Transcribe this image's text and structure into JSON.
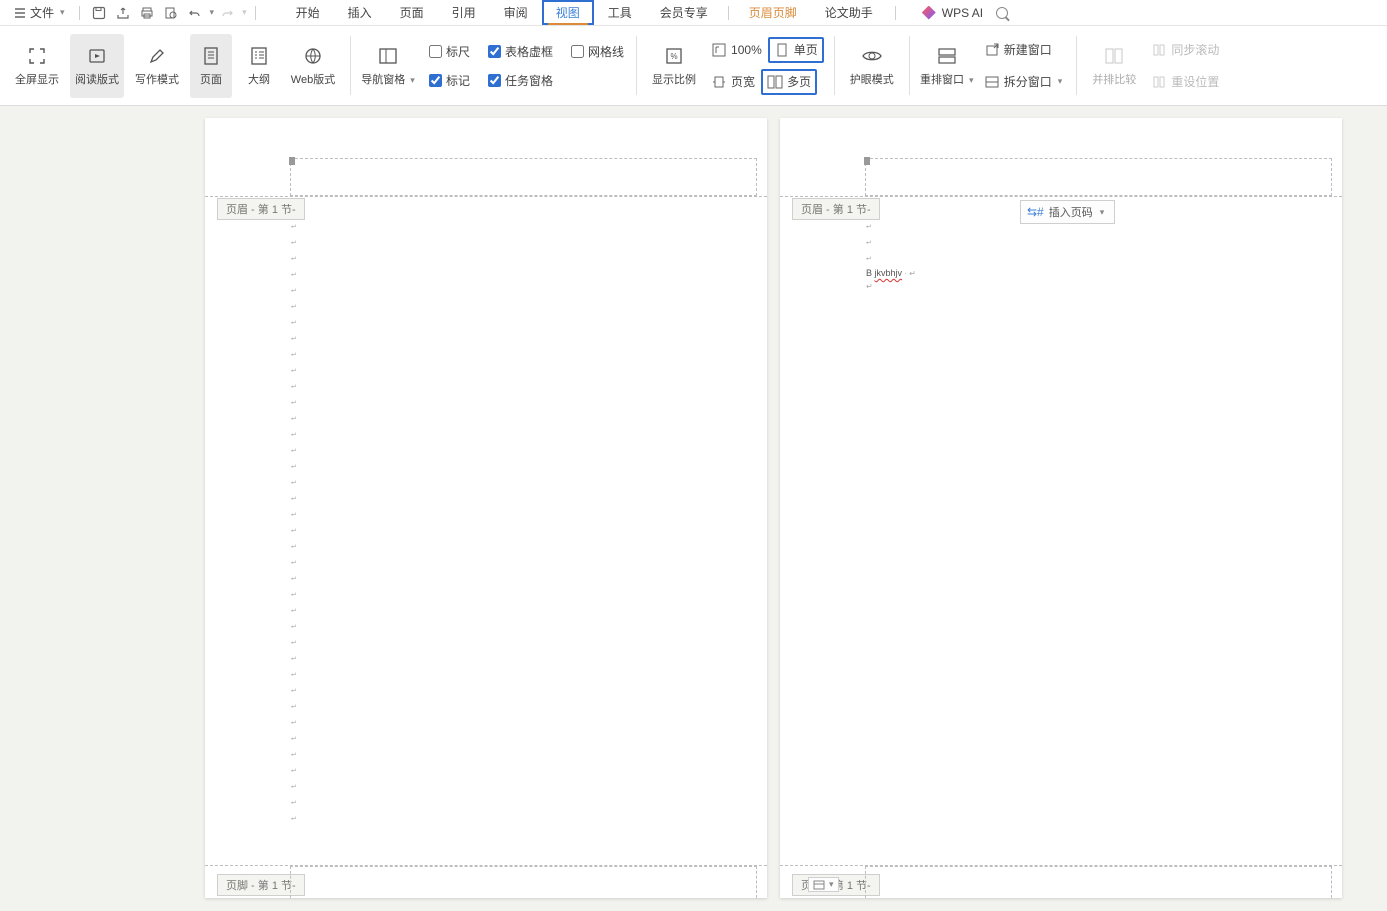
{
  "menu": {
    "file_label": "文件",
    "tabs": [
      "开始",
      "插入",
      "页面",
      "引用",
      "审阅",
      "视图",
      "工具",
      "会员专享",
      "页眉页脚",
      "论文助手"
    ],
    "active_tab": "视图",
    "orange_tab": "页眉页脚",
    "wps_ai": "WPS AI"
  },
  "ribbon": {
    "fullscreen": "全屏显示",
    "read_mode": "阅读版式",
    "write_mode": "写作模式",
    "page_view": "页面",
    "outline": "大纲",
    "web_view": "Web版式",
    "nav_pane": "导航窗格",
    "ruler": "标尺",
    "table_dashed": "表格虚框",
    "gridlines": "网格线",
    "markup": "标记",
    "task_pane": "任务窗格",
    "show_ratio": "显示比例",
    "zoom_100": "100%",
    "page_width": "页宽",
    "single_page": "单页",
    "multi_page": "多页",
    "eye_mode": "护眼模式",
    "arrange": "重排窗口",
    "new_window": "新建窗口",
    "split_window": "拆分窗口",
    "side_by_side": "并排比较",
    "sync_scroll": "同步滚动",
    "reset_pos": "重设位置"
  },
  "doc": {
    "header_tag": "页眉 - 第 1 节-",
    "footer_tag": "页脚 - 第 1 节-",
    "insert_pagenum": "插入页码",
    "page2_text_prefix": "B ",
    "page2_text": "jkvbhjv"
  }
}
